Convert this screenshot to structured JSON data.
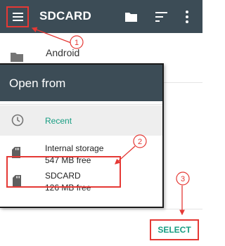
{
  "app_bar": {
    "title": "SDCARD",
    "icons": [
      "menu-icon",
      "folder-icon",
      "sort-icon",
      "more-vert-icon"
    ],
    "color": "#3c4c56"
  },
  "background_list": {
    "items": [
      {
        "label": "Android",
        "icon": "folder-icon"
      }
    ]
  },
  "drawer": {
    "title": "Open from",
    "items": [
      {
        "label": "Recent",
        "icon": "clock-icon"
      },
      {
        "label": "Internal storage",
        "sub": "547 MB free",
        "icon": "sdcard-icon"
      },
      {
        "label": "SDCARD",
        "sub": "126 MB free",
        "icon": "sdcard-icon"
      }
    ]
  },
  "actions": {
    "select_label": "SELECT"
  },
  "annotations": {
    "callouts": [
      "1",
      "2",
      "3"
    ],
    "color": "#e53935"
  },
  "colors": {
    "accent": "#179d82",
    "highlight": "#e53935",
    "header": "#3c4c56"
  }
}
